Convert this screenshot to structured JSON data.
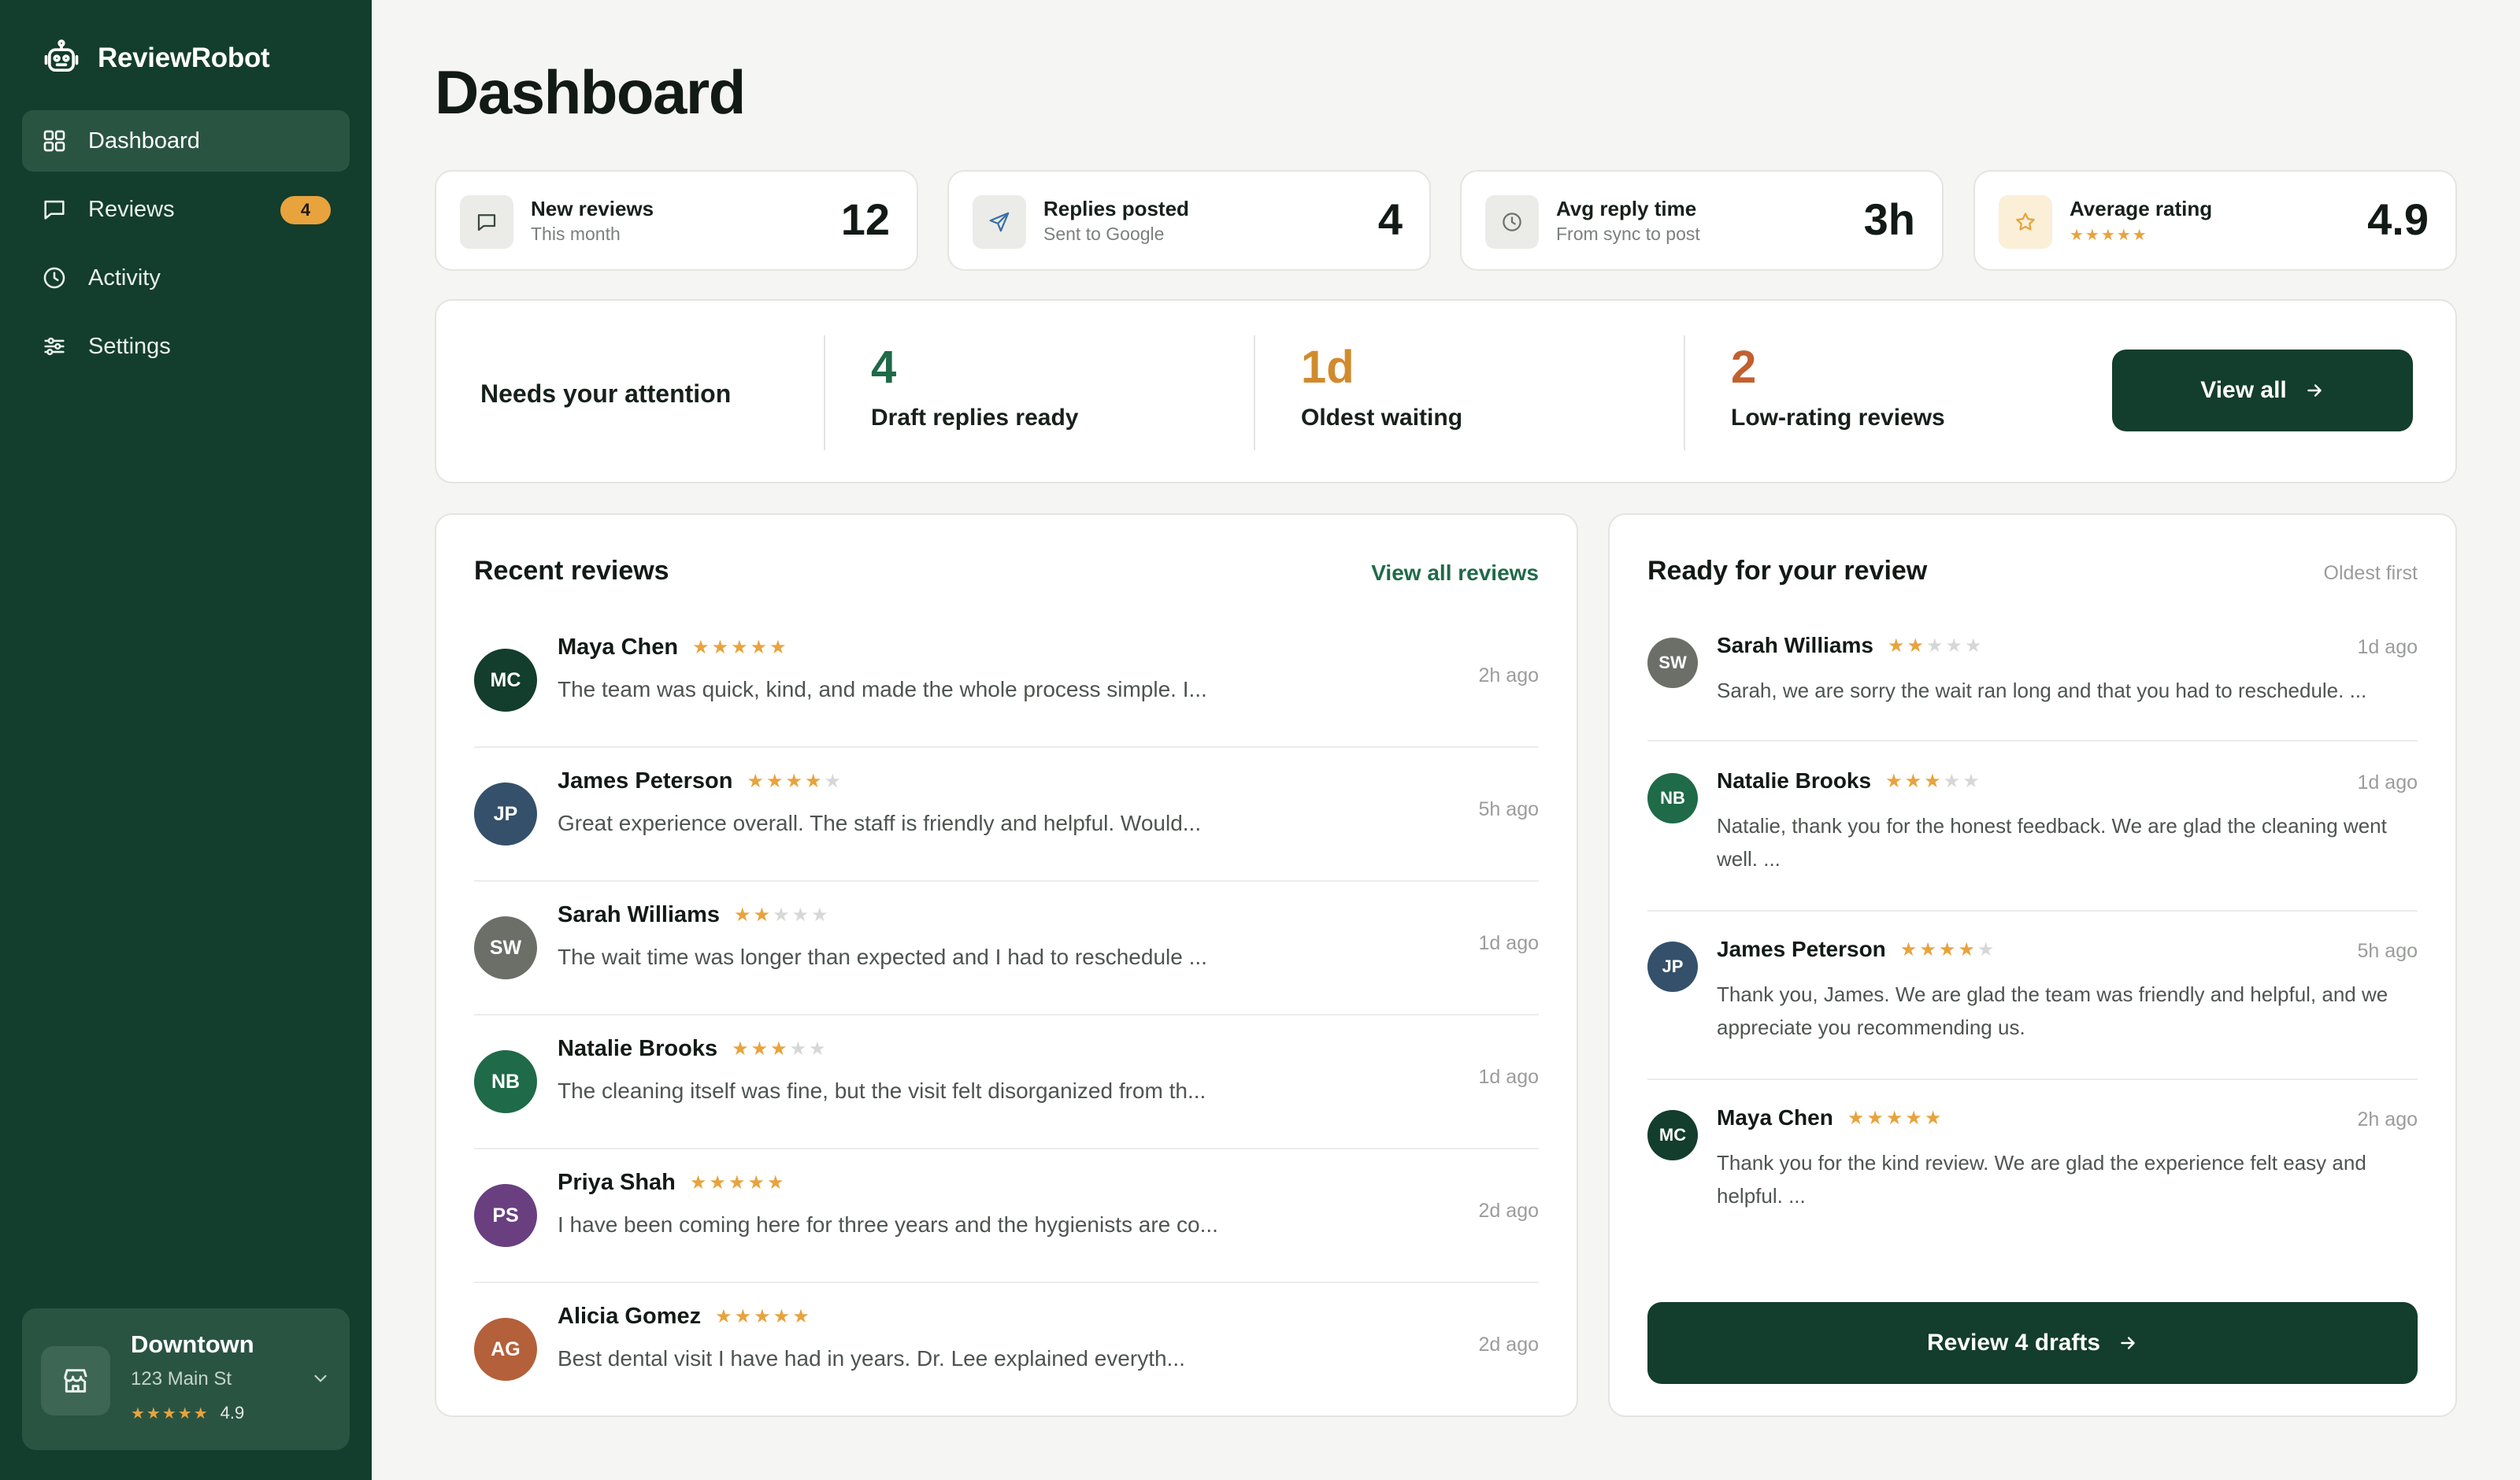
{
  "app": {
    "name": "ReviewRobot"
  },
  "sidebar": {
    "items": [
      {
        "label": "Dashboard",
        "icon": "grid-icon",
        "active": true
      },
      {
        "label": "Reviews",
        "icon": "message-icon",
        "badge": "4"
      },
      {
        "label": "Activity",
        "icon": "clock-icon"
      },
      {
        "label": "Settings",
        "icon": "sliders-icon"
      }
    ],
    "location": {
      "name": "Downtown",
      "address": "123 Main St",
      "stars": "★★★★★",
      "rating": "4.9"
    }
  },
  "page": {
    "title": "Dashboard"
  },
  "stats": [
    {
      "label": "New reviews",
      "sub": "This month",
      "value": "12",
      "icon": "message-icon"
    },
    {
      "label": "Replies posted",
      "sub": "Sent to Google",
      "value": "4",
      "icon": "send-icon"
    },
    {
      "label": "Avg reply time",
      "sub": "From sync to post",
      "value": "3h",
      "icon": "clock-icon"
    },
    {
      "label": "Average rating",
      "sub": "★★★★★",
      "value": "4.9",
      "icon": "star-icon"
    }
  ],
  "attention": {
    "title": "Needs your attention",
    "items": [
      {
        "value": "4",
        "label": "Draft replies ready",
        "color": "#1f6a48"
      },
      {
        "value": "1d",
        "label": "Oldest waiting",
        "color": "#d18b2e"
      },
      {
        "value": "2",
        "label": "Low-rating reviews",
        "color": "#c2602e"
      }
    ],
    "button": "View all"
  },
  "recent": {
    "title": "Recent reviews",
    "link": "View all reviews",
    "items": [
      {
        "initials": "MC",
        "name": "Maya Chen",
        "stars_on": "★★★★★",
        "stars_off": "",
        "text": "The team was quick, kind, and made the whole process simple. I...",
        "time": "2h ago",
        "color": "#133d2c"
      },
      {
        "initials": "JP",
        "name": "James Peterson",
        "stars_on": "★★★★",
        "stars_off": "★",
        "text": "Great experience overall. The staff is friendly and helpful. Would...",
        "time": "5h ago",
        "color": "#34506b"
      },
      {
        "initials": "SW",
        "name": "Sarah Williams",
        "stars_on": "★★",
        "stars_off": "★★★",
        "text": "The wait time was longer than expected and I had to reschedule ...",
        "time": "1d ago",
        "color": "#6b6f68"
      },
      {
        "initials": "NB",
        "name": "Natalie Brooks",
        "stars_on": "★★★",
        "stars_off": "★★",
        "text": "The cleaning itself was fine, but the visit felt disorganized from th...",
        "time": "1d ago",
        "color": "#1f6a48"
      },
      {
        "initials": "PS",
        "name": "Priya Shah",
        "stars_on": "★★★★★",
        "stars_off": "",
        "text": "I have been coming here for three years and the hygienists are co...",
        "time": "2d ago",
        "color": "#6a3f80"
      },
      {
        "initials": "AG",
        "name": "Alicia Gomez",
        "stars_on": "★★★★★",
        "stars_off": "",
        "text": "Best dental visit I have had in years. Dr. Lee explained everyth...",
        "time": "2d ago",
        "color": "#b4603a"
      }
    ]
  },
  "drafts": {
    "title": "Ready for your review",
    "sort": "Oldest first",
    "items": [
      {
        "initials": "SW",
        "name": "Sarah Williams",
        "stars_on": "★★",
        "stars_off": "★★★",
        "text": "Sarah, we are sorry the wait ran long and that you had to reschedule. ...",
        "time": "1d ago",
        "color": "#6b6f68"
      },
      {
        "initials": "NB",
        "name": "Natalie Brooks",
        "stars_on": "★★★",
        "stars_off": "★★",
        "text": "Natalie, thank you for the honest feedback. We are glad the cleaning went well. ...",
        "time": "1d ago",
        "color": "#1f6a48"
      },
      {
        "initials": "JP",
        "name": "James Peterson",
        "stars_on": "★★★★",
        "stars_off": "★",
        "text": "Thank you, James. We are glad the team was friendly and helpful, and we appreciate you recommending us.",
        "time": "5h ago",
        "color": "#34506b"
      },
      {
        "initials": "MC",
        "name": "Maya Chen",
        "stars_on": "★★★★★",
        "stars_off": "",
        "text": "Thank you for the kind review. We are glad the experience felt easy and helpful. ...",
        "time": "2h ago",
        "color": "#133d2c"
      }
    ],
    "button": "Review 4 drafts"
  }
}
